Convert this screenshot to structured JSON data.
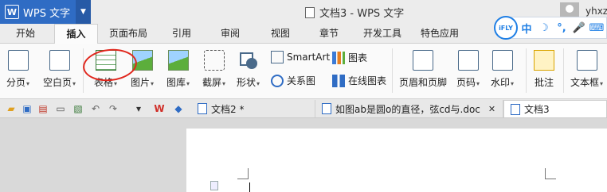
{
  "app": {
    "name": "WPS 文字",
    "logo_letter": "W",
    "title": "文档3 - WPS 文字",
    "user": "yhxz"
  },
  "tabs": [
    "开始",
    "插入",
    "页面布局",
    "引用",
    "审阅",
    "视图",
    "章节",
    "开发工具",
    "特色应用"
  ],
  "active_tab": "插入",
  "ifly": {
    "badge": "iFLY",
    "items": [
      "中",
      "☽",
      "°,",
      "🎤",
      "⌨"
    ]
  },
  "ribbon": {
    "page_break": "分页",
    "blank_page": "空白页",
    "table": "表格",
    "picture": "图片",
    "gallery": "图库",
    "screenshot": "截屏",
    "shapes": "形状",
    "smartart": "SmartArt",
    "chart": "图表",
    "relation_chart": "关系图",
    "online_chart": "在线图表",
    "header_footer": "页眉和页脚",
    "page_number": "页码",
    "watermark": "水印",
    "comment": "批注",
    "textbox": "文本框"
  },
  "doc_tabs": [
    {
      "label": "文档2 *"
    },
    {
      "label": "如图ab是圆o的直径，弦cd与.doc"
    },
    {
      "label": "文档3"
    }
  ],
  "colors": {
    "accent": "#2f6cc4",
    "highlight": "#e0261c"
  }
}
